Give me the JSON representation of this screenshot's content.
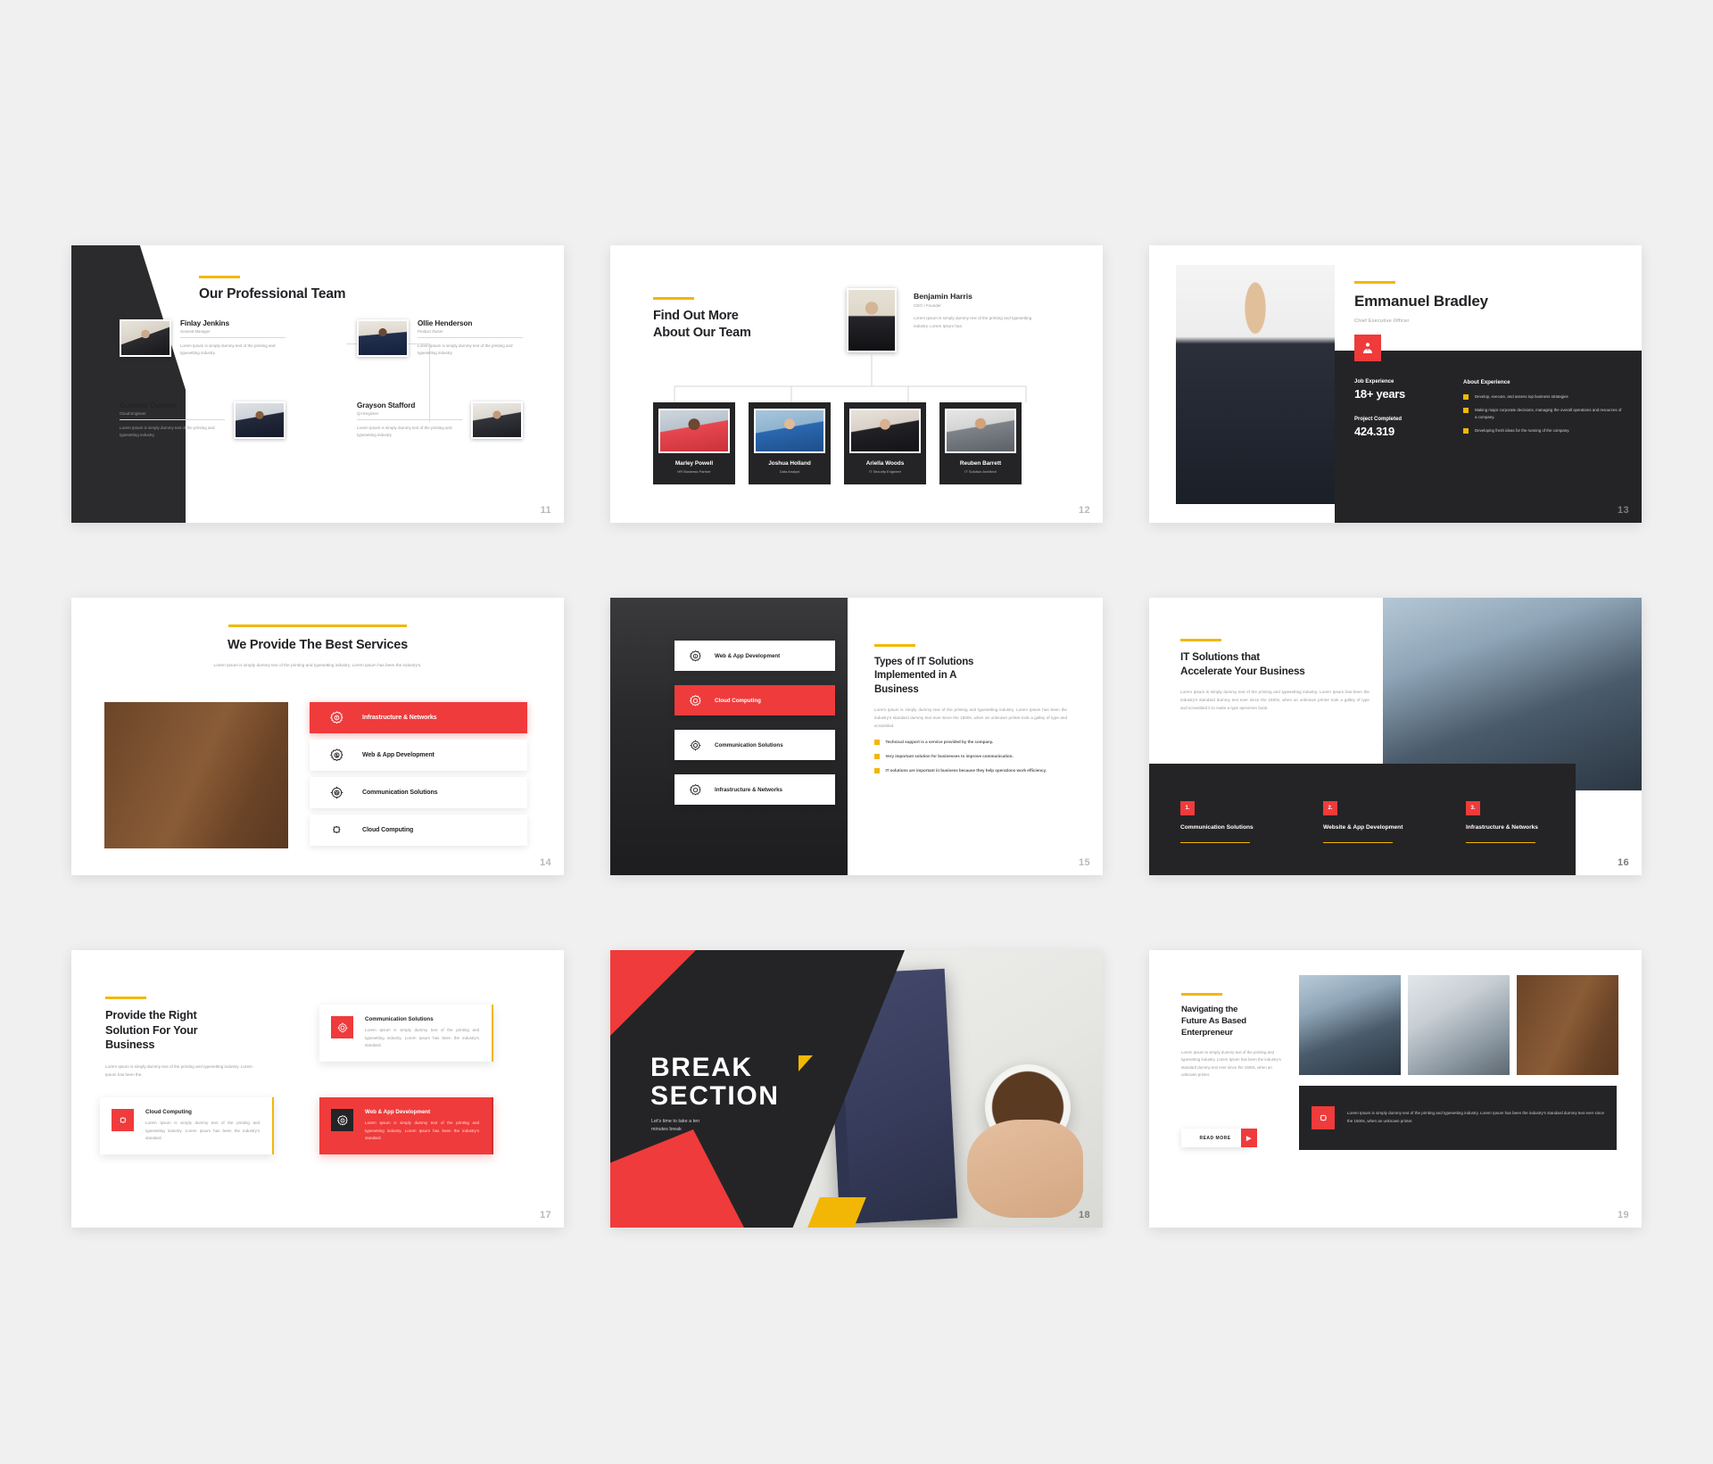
{
  "deck": {
    "accent_red": "#ef3b3b",
    "accent_yellow": "#f2b705",
    "dark": "#242426"
  },
  "slide11": {
    "page": "11",
    "title": "Our Professional Team",
    "members": [
      {
        "name": "Finlay Jenkins",
        "role": "General Manager",
        "text": "Lorem Ipsum is simply dummy text of the printing and typesetting industry."
      },
      {
        "name": "Ollie Henderson",
        "role": "Product Owner",
        "text": "Lorem Ipsum is simply dummy text of the printing and typesetting industry."
      },
      {
        "name": "Gustavo Duncan",
        "role": "Cloud Engineer",
        "text": "Lorem Ipsum is simply dummy text of the printing and typesetting industry."
      },
      {
        "name": "Grayson Stafford",
        "role": "QA Engineer",
        "text": "Lorem Ipsum is simply dummy text of the printing and typesetting industry."
      }
    ]
  },
  "slide12": {
    "page": "12",
    "title_line1": "Find Out More",
    "title_line2": "About Our Team",
    "lead": {
      "name": "Benjamin Harris",
      "role": "CEO / Founder",
      "text": "Lorem Ipsum is simply dummy text of the printing and typesetting industry.  Lorem Ipsum has."
    },
    "cards": [
      {
        "name": "Marley Powell",
        "role": "HR Business Partner"
      },
      {
        "name": "Joshua Holland",
        "role": "Data Analyst"
      },
      {
        "name": "Ariella Woods",
        "role": "IT Security Engineer"
      },
      {
        "name": "Reuben Barrett",
        "role": "IT Solution Architect"
      }
    ]
  },
  "slide13": {
    "page": "13",
    "name": "Emmanuel Bradley",
    "role": "Chief Executive Officer",
    "badge_icon": "user-tie-icon",
    "stats": [
      {
        "label": "Job Experience",
        "value": "18+ years"
      },
      {
        "label": "Project Completed",
        "value": "424.319"
      }
    ],
    "about_heading": "About Experience",
    "about_items": [
      "Develop, execute, and assess top business strategies",
      "Making major corporate decisions, managing the overall operations and resources of a company.",
      "Developing fresh ideas for the running of the company."
    ]
  },
  "slide14": {
    "page": "14",
    "title": "We Provide The Best Services",
    "subtitle": "Lorem Ipsum is simply dummy text of the printing and typesetting industry.  Lorem Ipsum has been the industry's.",
    "services": [
      {
        "label": "Infrastructure & Networks",
        "icon": "gear-cog-icon",
        "active": true
      },
      {
        "label": "Web & App Development",
        "icon": "dollar-badge-icon",
        "active": false
      },
      {
        "label": "Communication Solutions",
        "icon": "target-star-icon",
        "active": false
      },
      {
        "label": "Cloud Computing",
        "icon": "cloud-puzzle-icon",
        "active": false
      }
    ]
  },
  "slide15": {
    "page": "15",
    "menu": [
      {
        "label": "Web & App Development",
        "icon": "dollar-badge-icon",
        "active": false
      },
      {
        "label": "Cloud Computing",
        "icon": "gear-cog-icon",
        "active": true
      },
      {
        "label": "Communication Solutions",
        "icon": "target-star-icon",
        "active": false
      },
      {
        "label": "Infrastructure & Networks",
        "icon": "gear-cog-icon",
        "active": false
      }
    ],
    "title_line1": "Types of IT Solutions",
    "title_line2": "Implemented in A",
    "title_line3": "Business",
    "paragraph": "Lorem Ipsum is simply dummy text of the printing and typesetting industry.  Lorem Ipsum has been the industry's standard dummy text ever since the 1500s,  when an unknown printer took a galley of type and scrambled.",
    "bullets": [
      "Technical support is a service provided by the company.",
      "Very important solution for businesses to improve communication.",
      "IT solutions are important in business because they help operations work efficiency."
    ]
  },
  "slide16": {
    "page": "16",
    "title_line1": "IT Solutions that",
    "title_line2": "Accelerate Your Business",
    "paragraph": "Lorem Ipsum is simply dummy text of the printing and typesetting industry.  Lorem Ipsum has been the industry's standard dummy text ever since the 1500s,  when an unknown printer took a galley of type and scrambled it to make a type specimen book.",
    "items": [
      {
        "num": "1.",
        "label": "Communication Solutions"
      },
      {
        "num": "2.",
        "label": "Website & App Development"
      },
      {
        "num": "3.",
        "label": "Infrastructure & Networks"
      }
    ]
  },
  "slide17": {
    "page": "17",
    "title_line1": "Provide the Right",
    "title_line2": "Solution For Your",
    "title_line3": "Business",
    "paragraph": "Lorem Ipsum is simply dummy text of the printing and typesetting industry.  Lorem Ipsum has been the.",
    "cards": [
      {
        "title": "Communication Solutions",
        "icon": "target-star-icon",
        "text": "Lorem Ipsum is simply dummy text of the printing and typesetting industry. Lorem Ipsum has been the industry's standard.",
        "highlight": false
      },
      {
        "title": "Cloud Computing",
        "icon": "cloud-puzzle-icon",
        "text": "Lorem Ipsum is simply dummy text of the printing and typesetting industry. Lorem Ipsum has been the industry's standard.",
        "highlight": false
      },
      {
        "title": "Web & App Development",
        "icon": "dollar-badge-icon",
        "text": "Lorem Ipsum is simply dummy text of the printing and typesetting industry. Lorem Ipsum has been the industry's standard.",
        "highlight": true
      }
    ]
  },
  "slide18": {
    "page": "18",
    "title_line1": "BREAK",
    "title_line2": "SECTION",
    "subtitle_line1": "Let's time to take a ten",
    "subtitle_line2": "minutes break"
  },
  "slide19": {
    "page": "19",
    "title_line1": "Navigating the",
    "title_line2": "Future As Based",
    "title_line3": "Enterpreneur",
    "paragraph": "Lorem Ipsum is simply dummy text of the printing and typesetting industry.  Lorem Ipsum has been the industry's standard dummy text ever since the 1500s, when an unknown printer.",
    "button_label": "READ MORE",
    "strip_icon": "cloud-puzzle-icon",
    "strip_text": "Lorem Ipsum is simply dummy text of the printing and typesetting industry.  Lorem Ipsum has been the industry's standard dummy text ever since the 1500s, when an unknown printer."
  }
}
